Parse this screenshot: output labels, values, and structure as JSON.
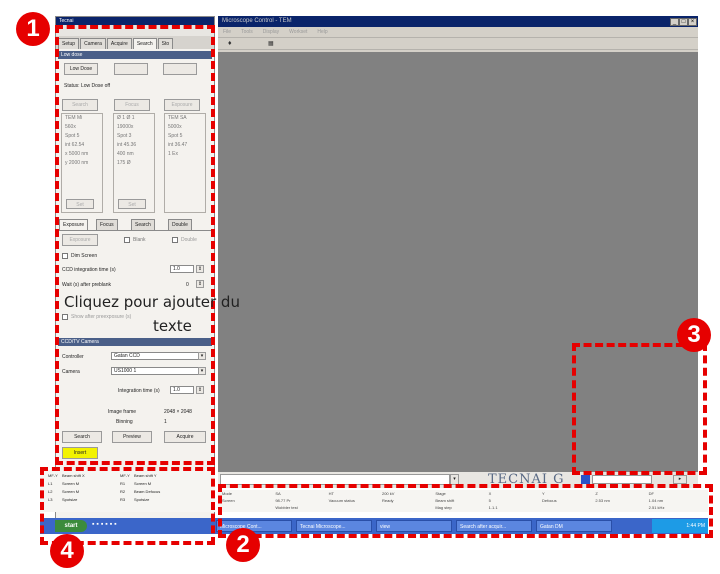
{
  "left_panel": {
    "title": "Tecnai",
    "tabs": [
      "Setup",
      "Camera",
      "Acquire",
      "Search",
      "Sto"
    ],
    "low_dose_section": "Low dose",
    "low_dose_button": "Low Dose",
    "status_text": "Status: Low Dose off",
    "columns": [
      {
        "button": "Search",
        "lines": [
          "TEM Mi",
          "560x",
          "Spot 5",
          "int 62.54",
          "x 5000 nm",
          "y 2000 nm"
        ],
        "bottom_button": "Set"
      },
      {
        "button": "Focus",
        "lines": [
          "Ø 1   Ø 1",
          "19000x",
          "Spot 3",
          "int 45.36",
          "400 nm",
          "175 Ø"
        ],
        "bottom_button": "Set"
      },
      {
        "button": "Exposure",
        "lines": [
          "TEM SA",
          "5000x",
          "Spot 5",
          "int 36.47",
          "",
          "1 Ex"
        ],
        "bottom_button": ""
      }
    ],
    "subtabs": [
      "Exposure",
      "Focus",
      "Search",
      "Double"
    ],
    "expose_button": "Exposure",
    "shutter_label": "Blank",
    "double_label": "Double",
    "dim_screen_label": "Dim Screen",
    "ccd_integration_label": "CCD integration time (s)",
    "ccd_integration_value": "1.0",
    "wait_label": "Wait (s) after preblank",
    "wait_value": "0",
    "show_label": "Show after preexposure (s)",
    "camera_section": "CCD/TV Camera",
    "controller_label": "Controller",
    "controller_value": "Gatan CCD",
    "camera_label": "Camera",
    "camera_value": "US1000 1",
    "integration_label": "Integration time (s)",
    "integration_value": "1.0",
    "image_frame_label": "Image frame",
    "image_frame_value": "2048 × 2048",
    "binning_label": "Binning",
    "binning_value": "1",
    "search_button": "Search",
    "preview_button": "Preview",
    "acquire_button": "Acquire",
    "insert_button": "Insert"
  },
  "main_window": {
    "title": "Microscope Control - TEM",
    "menu": [
      "File",
      "Tools",
      "Display",
      "Workset",
      "Help"
    ],
    "brand": "TECNAI G",
    "window_controls": [
      "_",
      "□",
      "×"
    ]
  },
  "left_status": {
    "rows": [
      [
        "MF-Y",
        "Beam shift X",
        "MF-Y",
        "Beam shift Y"
      ],
      [
        "L1",
        "Screen M",
        "R1",
        "Screen M"
      ],
      [
        "L2",
        "Screen M",
        "R2",
        "Beam Defocus"
      ],
      [
        "L3",
        "Spotsize",
        "R3",
        "Spotsize"
      ]
    ]
  },
  "status_bar": {
    "row1": [
      "Mode",
      "SA",
      "HT",
      "200 kV",
      "Stage",
      "X",
      "Y",
      "Z",
      "DF"
    ],
    "row2": [
      "Screen",
      "98.77 Pr",
      "Vacuum status",
      "Ready",
      "Beam shift",
      "5",
      "Defocus",
      "2.53 nm",
      "1.04 nm"
    ],
    "row3": [
      "",
      "Wobbler test",
      "",
      "",
      "Mag step",
      "1.1.1",
      "",
      "",
      "2.51 kHz"
    ]
  },
  "taskbar": {
    "start_label": "start",
    "tasks": [
      "Microscope Cont...",
      "Tecnai Microscope...",
      "view",
      "Search after acquir...",
      "Gatan DM"
    ],
    "clock": "1:44 PM"
  },
  "annotation": {
    "overlay_text_line1": "Cliquez pour ajouter du",
    "overlay_text_line2": "texte",
    "markers": [
      "1",
      "2",
      "3",
      "4"
    ],
    "dash_color": "#e60000"
  }
}
